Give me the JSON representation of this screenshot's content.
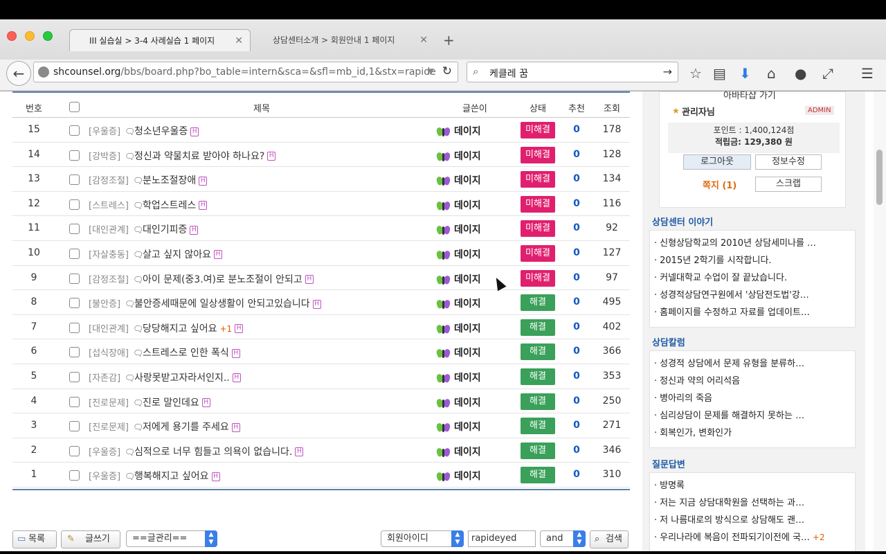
{
  "browser": {
    "tabs": [
      {
        "title": "III 실습실 > 3-4 사례실습 1 페이지",
        "active": true
      },
      {
        "title": "상담센터소개 > 회원안내 1 페이지",
        "active": false
      }
    ],
    "new_tab": "+",
    "url_host": "shcounsel.org",
    "url_rest": "/bbs/board.php?bo_table=intern&sca=&sfl=mb_id,1&stx=rapide",
    "search_query": "케클레 꿈"
  },
  "board": {
    "headers": {
      "num": "번호",
      "title": "제목",
      "author": "글쓴이",
      "status": "상태",
      "rec": "추천",
      "views": "조회"
    },
    "rows": [
      {
        "num": "15",
        "cat": "[우울증]",
        "title": "청소년우울증",
        "plus": "",
        "author": "데이지",
        "status": "미해결",
        "rec": "0",
        "views": "178"
      },
      {
        "num": "14",
        "cat": "[강박증]",
        "title": "정신과 약물치료 받아야 하나요?",
        "plus": "",
        "author": "데이지",
        "status": "미해결",
        "rec": "0",
        "views": "128"
      },
      {
        "num": "13",
        "cat": "[감정조절]",
        "title": "분노조절장애",
        "plus": "",
        "author": "데이지",
        "status": "미해결",
        "rec": "0",
        "views": "134"
      },
      {
        "num": "12",
        "cat": "[스트레스]",
        "title": "학업스트레스",
        "plus": "",
        "author": "데이지",
        "status": "미해결",
        "rec": "0",
        "views": "116"
      },
      {
        "num": "11",
        "cat": "[대인관계]",
        "title": "대인기피증",
        "plus": "",
        "author": "데이지",
        "status": "미해결",
        "rec": "0",
        "views": "92"
      },
      {
        "num": "10",
        "cat": "[자살충동]",
        "title": "살고 싶지 않아요",
        "plus": "",
        "author": "데이지",
        "status": "미해결",
        "rec": "0",
        "views": "127"
      },
      {
        "num": "9",
        "cat": "[감정조절]",
        "title": "아이 문제(중3.여)로 분노조절이 안되고",
        "plus": "",
        "author": "데이지",
        "status": "미해결",
        "rec": "0",
        "views": "97"
      },
      {
        "num": "8",
        "cat": "[불안증]",
        "title": "불안증세때문에 일상생활이 안되고있습니다",
        "plus": "",
        "author": "데이지",
        "status": "해결",
        "rec": "0",
        "views": "495"
      },
      {
        "num": "7",
        "cat": "[대인관계]",
        "title": "당당해지고 싶어요",
        "plus": "+1",
        "author": "데이지",
        "status": "해결",
        "rec": "0",
        "views": "402"
      },
      {
        "num": "6",
        "cat": "[섭식장애]",
        "title": "스트레스로 인한 폭식",
        "plus": "",
        "author": "데이지",
        "status": "해결",
        "rec": "0",
        "views": "366"
      },
      {
        "num": "5",
        "cat": "[자존감]",
        "title": "사랑못받고자라서인지..",
        "plus": "",
        "author": "데이지",
        "status": "해결",
        "rec": "0",
        "views": "353"
      },
      {
        "num": "4",
        "cat": "[진로문제]",
        "title": "진로 말인데요",
        "plus": "",
        "author": "데이지",
        "status": "해결",
        "rec": "0",
        "views": "250"
      },
      {
        "num": "3",
        "cat": "[진로문제]",
        "title": "저에게 용기를 주세요",
        "plus": "",
        "author": "데이지",
        "status": "해결",
        "rec": "0",
        "views": "271"
      },
      {
        "num": "2",
        "cat": "[우울증]",
        "title": "심적으로 너무 힘들고 의욕이 없습니다.",
        "plus": "",
        "author": "데이지",
        "status": "해결",
        "rec": "0",
        "views": "346"
      },
      {
        "num": "1",
        "cat": "[우울증]",
        "title": "행복해지고 싶어요",
        "plus": "",
        "author": "데이지",
        "status": "해결",
        "rec": "0",
        "views": "310"
      }
    ],
    "new_badge": "H"
  },
  "toolbar": {
    "list_label": "목록",
    "write_label": "글쓰기",
    "manage_select": "==글관리==",
    "search_field": "회원아이디",
    "search_value": "rapideyed",
    "search_op": "and",
    "search_button": "검색"
  },
  "sidebar": {
    "avatar_shop": "아바타샵 가기",
    "user_name": "관리자님",
    "admin_badge": "ADMIN",
    "points": "포인트 : 1,400,124점",
    "savings": "적립금: 129,380 원",
    "logout": "로그아웃",
    "edit_info": "정보수정",
    "memo": "쪽지 (1)",
    "scrap": "스크랩",
    "sections": [
      {
        "title": "상담센터 이야기",
        "items": [
          "신형상담학교의 2010년 상담세미나를 …",
          "2015년 2학기를 시작합니다.",
          "커넬대학교 수업이 잘 끝났습니다.",
          "성경적상담연구원에서 '상담전도법'강…",
          "홈페이지를 수정하고 자료를 업데이트…"
        ]
      },
      {
        "title": "상담칼럼",
        "items": [
          "성경적 상담에서 문제 유형을 분류하…",
          "정신과 약의 어리석음",
          "병아리의 죽음",
          "심리상담이 문제를 해결하지 못하는 …",
          "회복인가, 변화인가"
        ]
      },
      {
        "title": "질문답변",
        "items": [
          "방명록",
          "저는 지금 상담대학원을 선택하는 과…",
          "저 나름대로의 방식으로 상담해도 괜…",
          "우리나라에 복음이 전파되기이전에 국…"
        ]
      }
    ],
    "q_plus": "+2"
  },
  "colors": {
    "unresolved": "#e0206e",
    "resolved": "#3aa05a",
    "accent": "#1f5aa5"
  }
}
